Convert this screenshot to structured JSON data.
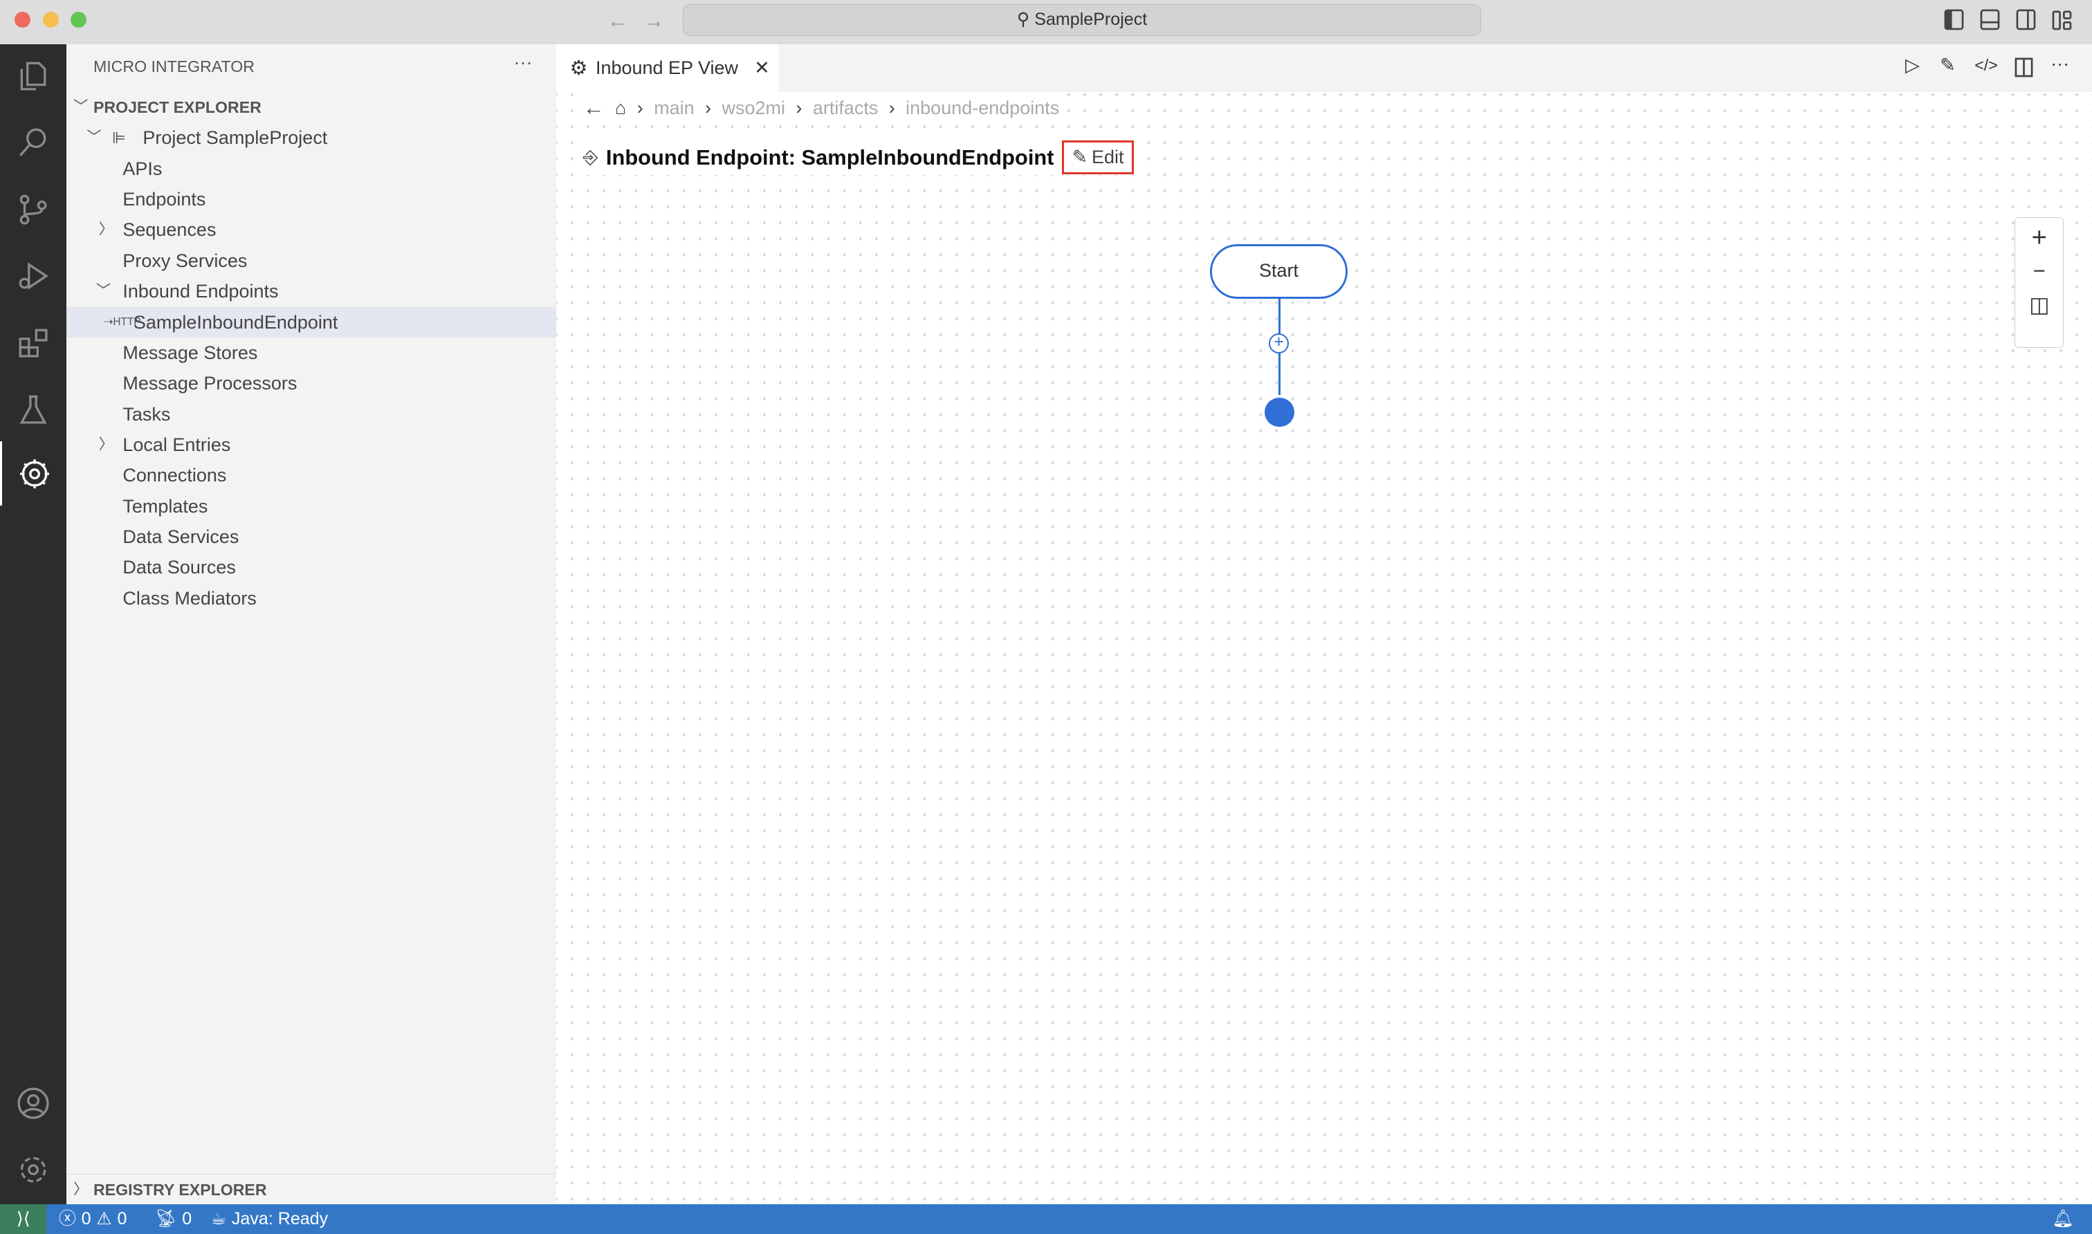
{
  "window": {
    "search_label": "SampleProject"
  },
  "sidebar": {
    "title": "MICRO INTEGRATOR",
    "project_explorer": "PROJECT EXPLORER",
    "project": "Project SampleProject",
    "items": [
      "APIs",
      "Endpoints",
      "Sequences",
      "Proxy Services",
      "Inbound Endpoints",
      "SampleInboundEndpoint",
      "Message Stores",
      "Message Processors",
      "Tasks",
      "Local Entries",
      "Connections",
      "Templates",
      "Data Services",
      "Data Sources",
      "Class Mediators"
    ],
    "registry_explorer": "REGISTRY EXPLORER"
  },
  "editor": {
    "tab_label": "Inbound EP View",
    "breadcrumb": [
      "main",
      "wso2mi",
      "artifacts",
      "inbound-endpoints"
    ],
    "title": "Inbound Endpoint: SampleInboundEndpoint",
    "edit_label": "Edit",
    "start_node": "Start",
    "accent": "#2f6fd6"
  },
  "status": {
    "errors": "0",
    "warnings": "0",
    "ports": "0",
    "java": "Java: Ready"
  }
}
